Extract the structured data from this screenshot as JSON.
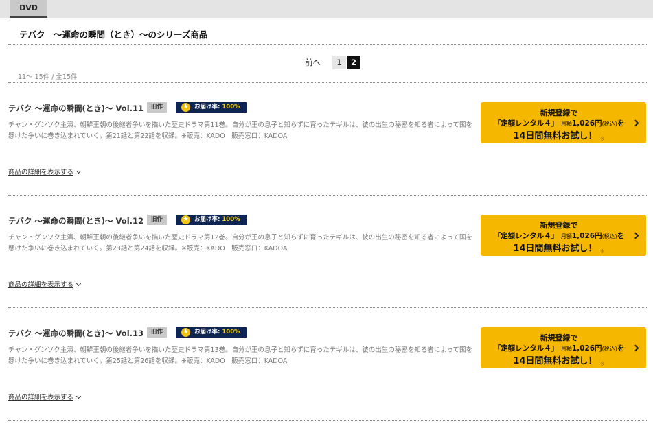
{
  "tabs": [
    {
      "label": "DVD"
    }
  ],
  "series_title": "テバク　～運命の瞬間（とき）～のシリーズ商品",
  "pagination": {
    "prev_label": "前へ",
    "pages": [
      "1",
      "2"
    ],
    "current": "2",
    "count_text": "11～ 15件 / 全15件"
  },
  "items": [
    {
      "title": "テバク ～運命の瞬間(とき)～ Vol.11",
      "badge_old": "旧作",
      "rate_label": "お届け率:",
      "rate_value": "100%",
      "description": "チャン・グンソク主演、朝鮮王朝の後継者争いを描いた歴史ドラマ第11巻。自分が王の息子と知らずに育ったテギルは、彼の出生の秘密を知る者によって国を懸けた争いに巻き込まれていく。第21話と第22話を収録。※販売：KADO　販売窓口：KADOA",
      "detail_link": "商品の詳細を表示する"
    },
    {
      "title": "テバク ～運命の瞬間(とき)～ Vol.12",
      "badge_old": "旧作",
      "rate_label": "お届け率:",
      "rate_value": "100%",
      "description": "チャン・グンソク主演、朝鮮王朝の後継者争いを描いた歴史ドラマ第12巻。自分が王の息子と知らずに育ったテギルは、彼の出生の秘密を知る者によって国を懸けた争いに巻き込まれていく。第23話と第24話を収録。※販売：KADO　販売窓口：KADOA",
      "detail_link": "商品の詳細を表示する"
    },
    {
      "title": "テバク ～運命の瞬間(とき)～ Vol.13",
      "badge_old": "旧作",
      "rate_label": "お届け率:",
      "rate_value": "100%",
      "description": "チャン・グンソク主演、朝鮮王朝の後継者争いを描いた歴史ドラマ第13巻。自分が王の息子と知らずに育ったテギルは、彼の出生の秘密を知る者によって国を懸けた争いに巻き込まれていく。第25話と第26話を収録。※販売：KADO　販売窓口：KADOA",
      "detail_link": "商品の詳細を表示する"
    }
  ],
  "cta": {
    "line1": "新規登録で",
    "line2_main": "「定額レンタル４」",
    "line2_small1": "月額",
    "line2_price": "1,026円",
    "line2_small2": "(税込)",
    "line2_end": "を",
    "line3": "14日間無料お試し！",
    "note": "※"
  },
  "colors": {
    "cta_bg": "#f6b700",
    "rate_badge_bg": "#0e2452",
    "rate_value": "#f6d52a",
    "old_badge_bg": "#c9c9c9",
    "current_page_bg": "#111111"
  }
}
